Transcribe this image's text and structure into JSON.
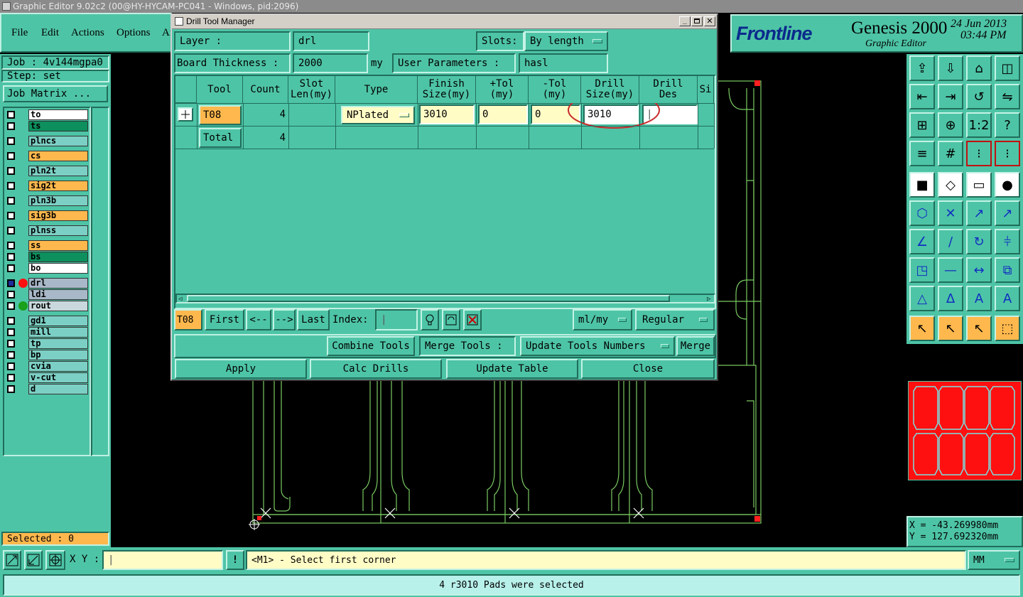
{
  "window_title": "Graphic Editor 9.02c2 (00@HY-HYCAM-PC041 - Windows, pid:2096)",
  "menu": [
    "File",
    "Edit",
    "Actions",
    "Options",
    "Ar"
  ],
  "brand": {
    "logo": "Frontline",
    "product": "Genesis 2000",
    "subtitle": "Graphic Editor",
    "date": "24 Jun 2013",
    "time": "03:44 PM"
  },
  "job": {
    "job_label": "Job : 4v144mgpa0",
    "step_label": "Step: set",
    "matrix_button": "Job Matrix ..."
  },
  "layers": [
    {
      "name": "to",
      "color": "#ffffff"
    },
    {
      "name": "ts",
      "color": "#0d8f5e"
    },
    {
      "name": "plncs",
      "color": "#7ccfc4"
    },
    {
      "name": "cs",
      "color": "#ffb84d"
    },
    {
      "name": "pln2t",
      "color": "#7ccfc4"
    },
    {
      "name": "sig2t",
      "color": "#ffb84d"
    },
    {
      "name": "pln3b",
      "color": "#7ccfc4"
    },
    {
      "name": "sig3b",
      "color": "#ffb84d"
    },
    {
      "name": "plnss",
      "color": "#7ccfc4"
    },
    {
      "name": "ss",
      "color": "#ffb84d"
    },
    {
      "name": "bs",
      "color": "#0d8f5e"
    },
    {
      "name": "bo",
      "color": "#ffffff"
    },
    {
      "name": "drl",
      "color": "#a8b8c8"
    },
    {
      "name": "ldi",
      "color": "#a8b8c8"
    },
    {
      "name": "rout",
      "color": "#c8d8dc"
    },
    {
      "name": "gd1",
      "color": "#7ccfc4"
    },
    {
      "name": "mill",
      "color": "#7ccfc4"
    },
    {
      "name": "tp",
      "color": "#7ccfc4"
    },
    {
      "name": "bp",
      "color": "#7ccfc4"
    },
    {
      "name": "cvia",
      "color": "#7ccfc4"
    },
    {
      "name": "v-cut",
      "color": "#7ccfc4"
    },
    {
      "name": "d",
      "color": "#7ccfc4"
    }
  ],
  "selected_label": "Selected : 0",
  "dialog": {
    "title": "Drill Tool Manager",
    "layer_label": "Layer :",
    "layer_value": "drl",
    "slots_label": "Slots:",
    "slots_value": "By length",
    "board_thickness_label": "Board Thickness :",
    "board_thickness_value": "2000",
    "board_thickness_unit": "my",
    "user_params_label": "User Parameters :",
    "user_params_value": "hasl",
    "columns": [
      "Tool",
      "Count",
      "Slot\nLen(my)",
      "Type",
      "Finish\nSize(my)",
      "+Tol\n(my)",
      "-Tol\n(my)",
      "Drill\nSize(my)",
      "Drill\nDes",
      "Si"
    ],
    "row": {
      "tool": "T08",
      "count": "4",
      "slot_len": "",
      "type": "NPlated",
      "finish": "3010",
      "ptol": "0",
      "mtol": "0",
      "drill_size": "3010",
      "drill_des": ""
    },
    "total": {
      "label": "Total",
      "count": "4"
    },
    "nav": {
      "current": "T08",
      "first": "First",
      "prev": "<--",
      "next": "-->",
      "last": "Last",
      "index_label": "Index:",
      "units": "ml/my",
      "mode": "Regular"
    },
    "combine_tools": "Combine Tools",
    "merge_tools_label": "Merge Tools :",
    "merge_option": "Update Tools Numbers",
    "merge_button": "Merge",
    "apply": "Apply",
    "calc_drills": "Calc Drills",
    "update_table": "Update Table",
    "close": "Close"
  },
  "coords": {
    "x": "X = -43.269980mm",
    "y": "Y = 127.692320mm"
  },
  "bottom": {
    "xy_label": "X Y :",
    "prompt": "<M1> - Select first corner",
    "unit": "MM",
    "status": "4 r3010 Pads were selected"
  }
}
